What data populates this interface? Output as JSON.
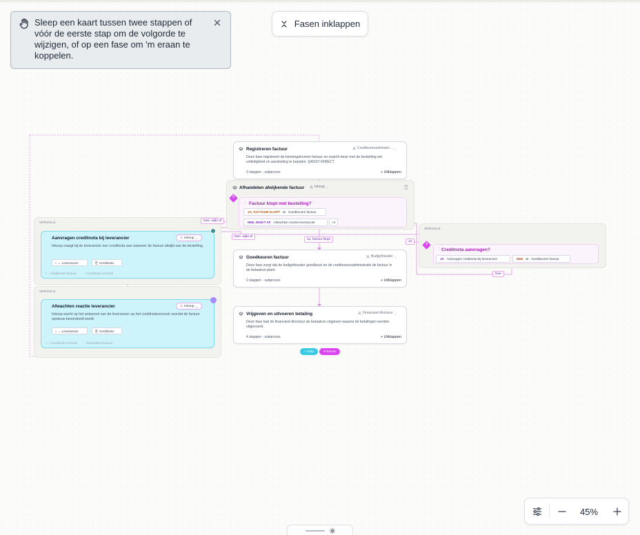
{
  "hint": {
    "text": "Sleep een kaart tussen twee stappen of vóór de eerste stap om de volgorde te wijzigen, of op een fase om 'm eraan te koppelen."
  },
  "toolbar": {
    "collapse_label": "Fasen inklappen"
  },
  "zoom": {
    "level": "45%"
  },
  "canvas": {
    "group_left_1": "VERVOLG",
    "group_left_2": "VERVOLG",
    "group_right": "VERVOLG",
    "registreren": {
      "title": "Registreren factuur",
      "role": "Crediteurenadministr…",
      "desc": "Deze fase registreert de binnengekomen factuur en matcht deze met de bestelling om volledigheid en aansluiting te bepalen. QASS7-DIRECT",
      "meta": "3 stappen · subproces",
      "expand": "Uitklappen"
    },
    "afhandelen": {
      "title": "Afhandelen afwijkende factuur",
      "role": "Inkoop",
      "decision_title": "Factuur klopt met bestelling?",
      "answer1_label": "JA, FACTUUR KLOPT",
      "answer1_target": "Goedkeuren factuur",
      "answer2_label": "NEE, WIJKT AF",
      "answer2_target": "Afwachten reactie leverancier",
      "more": "+3"
    },
    "goedkeuren": {
      "title": "Goedkeuren factuur",
      "role": "Budgethouder",
      "desc": "Deze fase zorgt dat de budgethouder goedkeurt en de crediteurenadministratie de factuur in de betaalrun plant.",
      "meta": "2 stappen · subproces",
      "expand": "Uitklappen"
    },
    "vrijgeven": {
      "title": "Vrijgeven en uitvoeren betaling",
      "role": "Financieel directeur",
      "desc": "Deze fase laat de financieel directeur de betaalrun vrijgeven waarna de betalingen worden uitgevoerd.",
      "meta": "4 stappen · subproces",
      "expand": "Uitklappen"
    },
    "aanvragen": {
      "title": "Aanvragen creditnota bij leverancier",
      "role": "Inkoop",
      "desc": "Inkoop vraagt bij de leverancier een creditnota aan wanneer de factuur afwijkt van de bestelling.",
      "chip1": "→ Leverancier",
      "chip2": "Creditnota",
      "link1": "Afwijkende factuur",
      "link2": "Creditnota verzoek"
    },
    "afwachten": {
      "title": "Afwachten reactie leverancier",
      "role": "Inkoop",
      "desc": "Inkoop wacht op het antwoord van de leverancier op het creditnotaverzoek voordat de factuur opnieuw beoordeeld wordt.",
      "chip1": "→ Leverancier",
      "chip2": "Creditnota",
      "link1": "Creditnota verzoek",
      "link2": "Reactieleverancier"
    },
    "creditnota_decision": {
      "title": "Creditnota aanvragen?",
      "answer1_label": "JA",
      "answer1_target": "Aanvragen creditnota bij leverancier",
      "answer2_label": "NEE",
      "answer2_target": "Goedkeuren factuur"
    },
    "edge_labels": {
      "nee_wijkt_af_1": "Nee, wijkt af",
      "nee_wijkt_af_2": "Nee, wijkt af",
      "ja_factuur_klopt": "Ja, factuur klopt",
      "ja": "Ja",
      "nee": "Nee"
    },
    "add_step": "+ Stap",
    "add_decision": "⟡ Keuze"
  },
  "colors": {
    "accent": "#d946ef",
    "cyan": "#22c7e0",
    "purple_handle": "#a78bfa",
    "teal_handle": "#3f8c8c"
  }
}
